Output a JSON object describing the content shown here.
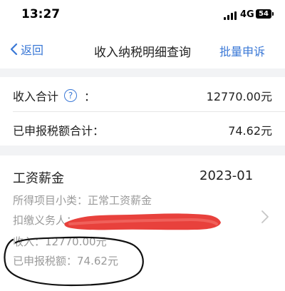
{
  "status_bar": {
    "time": "13:27",
    "network": "4G",
    "battery": "54"
  },
  "nav": {
    "back_label": "返回",
    "title": "收入纳税明细查询",
    "batch_label": "批量申诉"
  },
  "summary": {
    "income_total_label": "收入合计",
    "colon": "：",
    "income_total_value": "12770.00元",
    "tax_total_label": "已申报税额合计：",
    "tax_total_value": "74.62元"
  },
  "record": {
    "title": "工资薪金",
    "period": "2023-01",
    "subcategory": "所得项目小类：正常工资薪金",
    "withholder": "扣缴义务人：",
    "income": "收入：12770.00元",
    "tax": "已申报税额：74.62元"
  },
  "colors": {
    "accent": "#3a78d6",
    "redaction": "#e8413c",
    "background_gap": "#f2f3f5"
  }
}
